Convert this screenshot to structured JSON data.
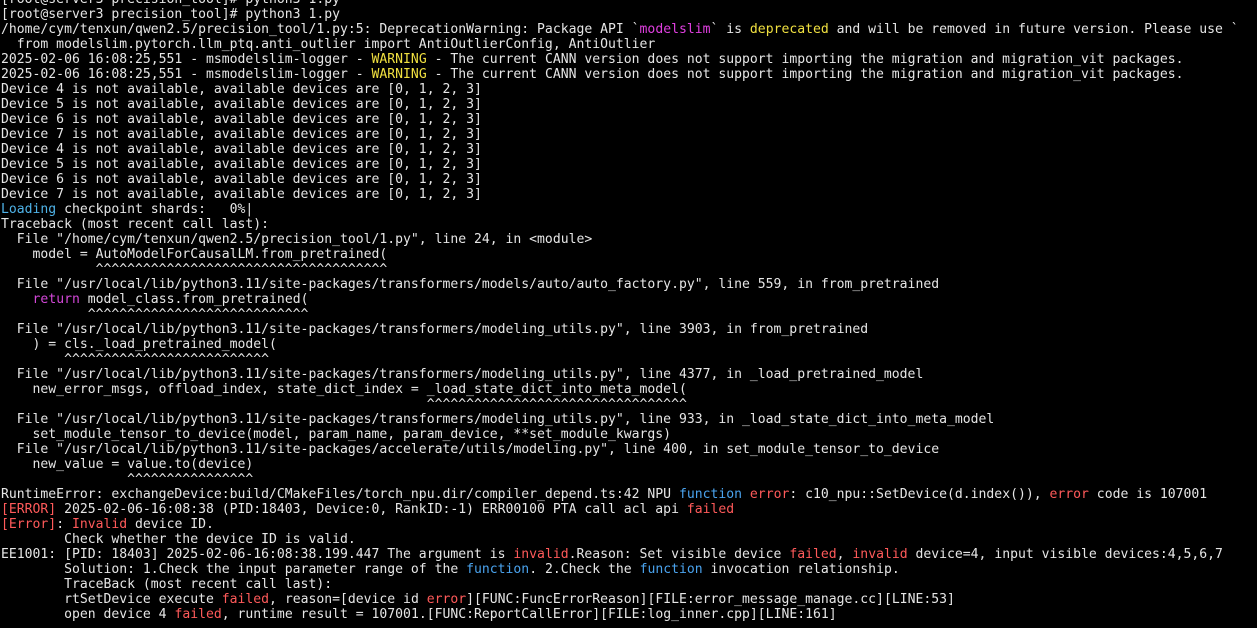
{
  "terminal": {
    "background": "#000000",
    "colors": {
      "text": "#e6e6e6",
      "warning": "#f0e040",
      "keyword": "#d347d8",
      "function": "#4aa3ee",
      "error": "#ff5a5a",
      "module": "#e03fe0",
      "info": "#4fb3e8"
    },
    "lines": [
      {
        "spans": [
          {
            "t": "[root@server3 precision_tool]# python3 1.py",
            "c": ""
          },
          {
            "t": "                                                   ",
            "c": ""
          }
        ]
      },
      {
        "spans": [
          {
            "t": "[root@server3 precision_tool]# python3 1.py",
            "c": ""
          }
        ]
      },
      {
        "spans": [
          {
            "t": "/home/cym/tenxun/qwen2.5/precision_tool/1.py:5: DeprecationWarning: Package API `",
            "c": ""
          },
          {
            "t": "modelslim",
            "c": "s-mod"
          },
          {
            "t": "` is ",
            "c": ""
          },
          {
            "t": "deprecated",
            "c": "s-warn"
          },
          {
            "t": " and will be removed in future version. Please use `",
            "c": ""
          }
        ]
      },
      {
        "spans": [
          {
            "t": "  from modelslim.pytorch.llm_ptq.anti_outlier import AntiOutlierConfig, AntiOutlier",
            "c": ""
          }
        ]
      },
      {
        "spans": [
          {
            "t": "2025-02-06 16:08:25,551 - msmodelslim-logger - ",
            "c": ""
          },
          {
            "t": "WARNING",
            "c": "s-warn"
          },
          {
            "t": " - The current CANN version does not support importing the migration and migration_vit packages.",
            "c": ""
          }
        ]
      },
      {
        "spans": [
          {
            "t": "2025-02-06 16:08:25,551 - msmodelslim-logger - ",
            "c": ""
          },
          {
            "t": "WARNING",
            "c": "s-warn"
          },
          {
            "t": " - The current CANN version does not support importing the migration and migration_vit packages.",
            "c": ""
          }
        ]
      },
      {
        "spans": [
          {
            "t": "Device 4 is not available, available devices are [0, 1, 2, 3]",
            "c": ""
          }
        ]
      },
      {
        "spans": [
          {
            "t": "Device 5 is not available, available devices are [0, 1, 2, 3]",
            "c": ""
          }
        ]
      },
      {
        "spans": [
          {
            "t": "Device 6 is not available, available devices are [0, 1, 2, 3]",
            "c": ""
          }
        ]
      },
      {
        "spans": [
          {
            "t": "Device 7 is not available, available devices are [0, 1, 2, 3]",
            "c": ""
          }
        ]
      },
      {
        "spans": [
          {
            "t": "Device 4 is not available, available devices are [0, 1, 2, 3]",
            "c": ""
          }
        ]
      },
      {
        "spans": [
          {
            "t": "Device 5 is not available, available devices are [0, 1, 2, 3]",
            "c": ""
          }
        ]
      },
      {
        "spans": [
          {
            "t": "Device 6 is not available, available devices are [0, 1, 2, 3]",
            "c": ""
          }
        ]
      },
      {
        "spans": [
          {
            "t": "Device 7 is not available, available devices are [0, 1, 2, 3]",
            "c": ""
          }
        ]
      },
      {
        "spans": [
          {
            "t": "Loading",
            "c": "s-cyan"
          },
          {
            "t": " checkpoint shards:   0%|",
            "c": ""
          }
        ]
      },
      {
        "spans": [
          {
            "t": "Traceback (most recent call last):",
            "c": ""
          }
        ]
      },
      {
        "spans": [
          {
            "t": "  File \"/home/cym/tenxun/qwen2.5/precision_tool/1.py\", line 24, in <module>",
            "c": ""
          }
        ]
      },
      {
        "spans": [
          {
            "t": "    model = AutoModelForCausalLM.from_pretrained(",
            "c": ""
          }
        ]
      },
      {
        "spans": [
          {
            "t": "            ^^^^^^^^^^^^^^^^^^^^^^^^^^^^^^^^^^^^^",
            "c": "s-hat"
          }
        ]
      },
      {
        "spans": [
          {
            "t": "  File \"/usr/local/lib/python3.11/site-packages/transformers/models/auto/auto_factory.py\", line 559, in from_pretrained",
            "c": ""
          }
        ]
      },
      {
        "spans": [
          {
            "t": "    ",
            "c": ""
          },
          {
            "t": "return",
            "c": "s-kw"
          },
          {
            "t": " model_class.from_pretrained(",
            "c": ""
          }
        ]
      },
      {
        "spans": [
          {
            "t": "           ^^^^^^^^^^^^^^^^^^^^^^^^^^^^",
            "c": "s-hat"
          }
        ]
      },
      {
        "spans": [
          {
            "t": "  File \"/usr/local/lib/python3.11/site-packages/transformers/modeling_utils.py\", line 3903, in from_pretrained",
            "c": ""
          }
        ]
      },
      {
        "spans": [
          {
            "t": "    ) = cls._load_pretrained_model(",
            "c": ""
          }
        ]
      },
      {
        "spans": [
          {
            "t": "        ^^^^^^^^^^^^^^^^^^^^^^^^^^",
            "c": "s-hat"
          }
        ]
      },
      {
        "spans": [
          {
            "t": "  File \"/usr/local/lib/python3.11/site-packages/transformers/modeling_utils.py\", line 4377, in _load_pretrained_model",
            "c": ""
          }
        ]
      },
      {
        "spans": [
          {
            "t": "    new_error_msgs, offload_index, state_dict_index = _load_state_dict_into_meta_model(",
            "c": ""
          }
        ]
      },
      {
        "spans": [
          {
            "t": "                                                      ^^^^^^^^^^^^^^^^^^^^^^^^^^^^^^^^^",
            "c": "s-hat"
          }
        ]
      },
      {
        "spans": [
          {
            "t": "  File \"/usr/local/lib/python3.11/site-packages/transformers/modeling_utils.py\", line 933, in _load_state_dict_into_meta_model",
            "c": ""
          }
        ]
      },
      {
        "spans": [
          {
            "t": "    set_module_tensor_to_device(model, param_name, param_device, **set_module_kwargs)",
            "c": ""
          }
        ]
      },
      {
        "spans": [
          {
            "t": "  File \"/usr/local/lib/python3.11/site-packages/accelerate/utils/modeling.py\", line 400, in set_module_tensor_to_device",
            "c": ""
          }
        ]
      },
      {
        "spans": [
          {
            "t": "    new_value = value.to(device)",
            "c": ""
          }
        ]
      },
      {
        "spans": [
          {
            "t": "                ^^^^^^^^^^^^^^^^",
            "c": "s-hat"
          }
        ]
      },
      {
        "spans": [
          {
            "t": "RuntimeError: exchangeDevice:build/CMakeFiles/torch_npu.dir/compiler_depend.ts:42 NPU ",
            "c": ""
          },
          {
            "t": "function",
            "c": "s-fn"
          },
          {
            "t": " ",
            "c": ""
          },
          {
            "t": "error",
            "c": "s-err"
          },
          {
            "t": ": c10_npu::SetDevice(d.index()), ",
            "c": ""
          },
          {
            "t": "error",
            "c": "s-err"
          },
          {
            "t": " code is 107001",
            "c": ""
          }
        ]
      },
      {
        "spans": [
          {
            "t": "[ERROR]",
            "c": "s-err"
          },
          {
            "t": " 2025-02-06-16:08:38 (PID:18403, Device:0, RankID:-1) ERR00100 PTA call acl api ",
            "c": ""
          },
          {
            "t": "failed",
            "c": "s-err"
          }
        ]
      },
      {
        "spans": [
          {
            "t": "[Error]",
            "c": "s-err"
          },
          {
            "t": ": ",
            "c": ""
          },
          {
            "t": "Invalid",
            "c": "s-err"
          },
          {
            "t": " device ID.",
            "c": ""
          }
        ]
      },
      {
        "spans": [
          {
            "t": "        Check whether the device ID is valid.",
            "c": ""
          }
        ]
      },
      {
        "spans": [
          {
            "t": "EE1001: [PID: 18403] 2025-02-06-16:08:38.199.447 The argument is ",
            "c": ""
          },
          {
            "t": "invalid",
            "c": "s-err"
          },
          {
            "t": ".Reason: Set visible device ",
            "c": ""
          },
          {
            "t": "failed",
            "c": "s-err"
          },
          {
            "t": ", ",
            "c": ""
          },
          {
            "t": "invalid",
            "c": "s-err"
          },
          {
            "t": " device=4, input visible devices:4,5,6,7",
            "c": ""
          }
        ]
      },
      {
        "spans": [
          {
            "t": "        Solution: 1.Check the input parameter range of the ",
            "c": ""
          },
          {
            "t": "function",
            "c": "s-fn"
          },
          {
            "t": ". 2.Check the ",
            "c": ""
          },
          {
            "t": "function",
            "c": "s-fn"
          },
          {
            "t": " invocation relationship.",
            "c": ""
          }
        ]
      },
      {
        "spans": [
          {
            "t": "        TraceBack (most recent call last):",
            "c": ""
          }
        ]
      },
      {
        "spans": [
          {
            "t": "        rtSetDevice execute ",
            "c": ""
          },
          {
            "t": "failed",
            "c": "s-err"
          },
          {
            "t": ", reason=[device id ",
            "c": ""
          },
          {
            "t": "error",
            "c": "s-err"
          },
          {
            "t": "][FUNC:FuncErrorReason][FILE:error_message_manage.cc][LINE:53]",
            "c": ""
          }
        ]
      },
      {
        "spans": [
          {
            "t": "        open device 4 ",
            "c": ""
          },
          {
            "t": "failed",
            "c": "s-err"
          },
          {
            "t": ", runtime result = 107001.[FUNC:ReportCallError][FILE:log_inner.cpp][LINE:161]",
            "c": ""
          }
        ]
      }
    ]
  }
}
